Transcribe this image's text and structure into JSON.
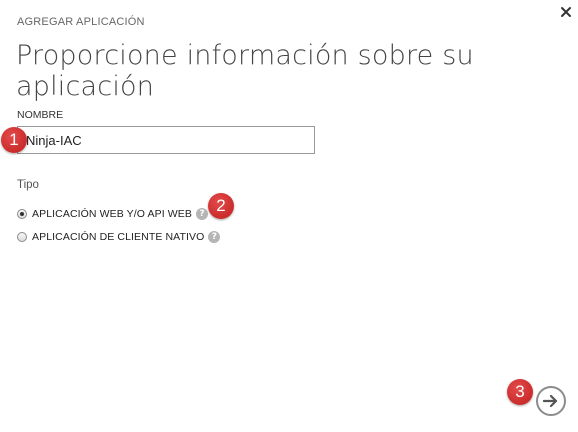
{
  "dialog": {
    "subtitle": "AGREGAR APLICACIÓN",
    "title": "Proporcione información sobre su aplicación",
    "close_icon": "close-icon"
  },
  "name_field": {
    "label": "NOMBRE",
    "value": "Ninja-IAC"
  },
  "type_group": {
    "label": "Tipo",
    "options": [
      {
        "label": "APLICACIÓN WEB Y/O API WEB",
        "selected": true,
        "help_icon": "help-icon"
      },
      {
        "label": "APLICACIÓN DE CLIENTE NATIVO",
        "selected": false,
        "help_icon": "help-icon"
      }
    ]
  },
  "annotations": [
    "1",
    "2",
    "3"
  ],
  "footer": {
    "next_icon": "arrow-right-icon"
  },
  "colors": {
    "badge": "#d23030",
    "border": "#9a9a9a",
    "help": "#b5b5b5"
  }
}
